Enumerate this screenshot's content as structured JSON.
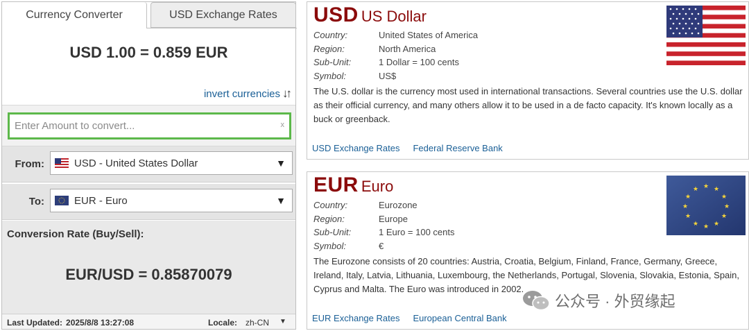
{
  "tabs": {
    "converter": "Currency Converter",
    "rates": "USD Exchange Rates"
  },
  "converter": {
    "headline": "USD 1.00 = 0.859 EUR",
    "invert_label": "invert currencies",
    "invert_icon": "swap-vertical-arrows",
    "amount_placeholder": "Enter Amount to convert...",
    "amount_value": "",
    "clear_glyph": "x",
    "from_label": "From:",
    "from_value": "USD - United States Dollar",
    "to_label": "To:",
    "to_value": "EUR - Euro",
    "conversion_label": "Conversion Rate (Buy/Sell):",
    "conversion_rate": "EUR/USD = 0.85870079",
    "last_updated_label": "Last Updated:",
    "last_updated_value": "2025/8/8 13:27:08",
    "locale_label": "Locale:",
    "locale_value": "zh-CN"
  },
  "usd_card": {
    "code": "USD",
    "name": "US Dollar",
    "flag": "us-flag",
    "facts": [
      {
        "key": "Country:",
        "value": "United States of America"
      },
      {
        "key": "Region:",
        "value": "North America"
      },
      {
        "key": "Sub-Unit:",
        "value": "1 Dollar = 100 cents"
      },
      {
        "key": "Symbol:",
        "value": "US$"
      }
    ],
    "description": "The U.S. dollar is the currency most used in international transactions. Several countries use the U.S. dollar as their official currency, and many others allow it to be used in a de facto capacity. It's known locally as a buck or greenback.",
    "links": [
      "USD Exchange Rates",
      "Federal Reserve Bank"
    ]
  },
  "eur_card": {
    "code": "EUR",
    "name": "Euro",
    "flag": "eu-flag",
    "facts": [
      {
        "key": "Country:",
        "value": "Eurozone"
      },
      {
        "key": "Region:",
        "value": "Europe"
      },
      {
        "key": "Sub-Unit:",
        "value": "1 Euro = 100 cents"
      },
      {
        "key": "Symbol:",
        "value": "€"
      }
    ],
    "description": "The Eurozone consists of 20 countries: Austria, Croatia, Belgium, Finland, France, Germany, Greece, Ireland, Italy, Latvia, Lithuania, Luxembourg, the Netherlands, Portugal, Slovenia, Slovakia, Estonia, Spain, Cyprus and Malta. The Euro was introduced in 2002.",
    "links": [
      "EUR Exchange Rates",
      "European Central Bank"
    ]
  },
  "watermark": {
    "text": "公众号 · 外贸缘起",
    "icon": "wechat-icon"
  },
  "colors": {
    "currency_heading": "#8b0b0b",
    "link": "#1a5f96",
    "input_focus_border": "#5cb84a"
  }
}
